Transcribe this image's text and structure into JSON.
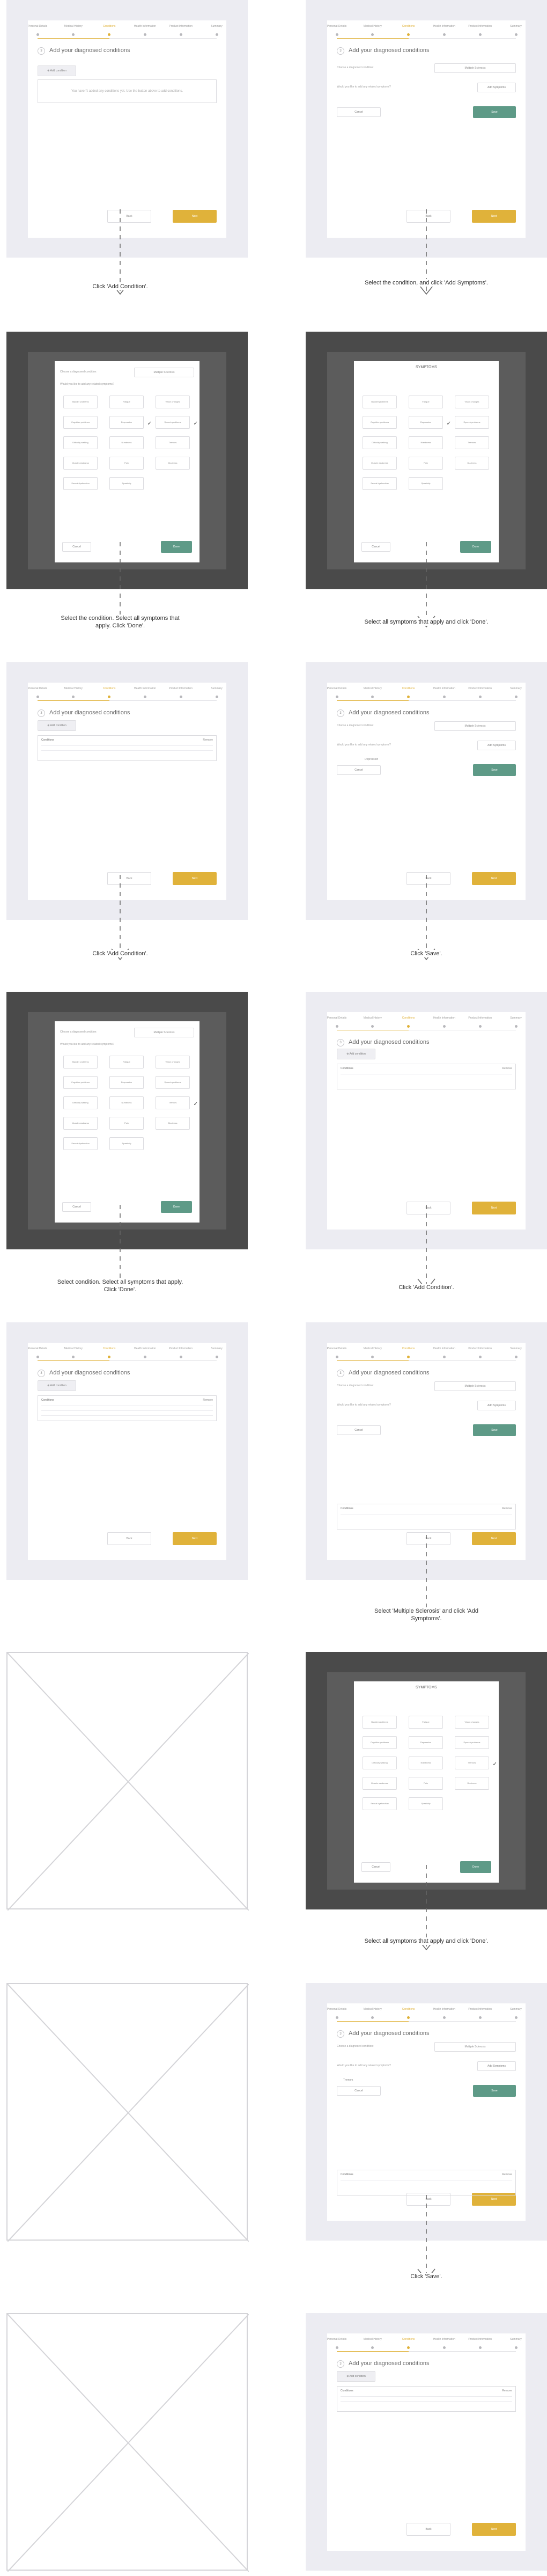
{
  "steps": [
    "Personal Details",
    "Medical History",
    "Conditions",
    "Health Information",
    "Product Information",
    "Summary"
  ],
  "section": {
    "number": "3",
    "title": "Add your diagnosed conditions"
  },
  "labels": {
    "add_condition": "Add condition",
    "empty": "You haven't added any conditions yet. Use the button above to add conditions.",
    "select_prompt": "Choose a diagnosed condition:",
    "select_value": "Multiple Sclerosis",
    "symptoms_prompt": "Would you like to add any related symptoms?",
    "add_symptoms": "Add Symptoms",
    "cancel": "Cancel",
    "save": "Save",
    "back": "Back",
    "next": "Next",
    "done": "Done",
    "symptoms_title": "SYMPTOMS",
    "conditions_header": "Conditions",
    "remove_header": "Remove"
  },
  "symptom_chips": [
    "Bladder problems",
    "Fatigue",
    "Vision changes",
    "Cognitive problems",
    "Depression",
    "Speech problems",
    "Difficulty walking",
    "Numbness",
    "Tremors",
    "Muscle weakness",
    "Pain",
    "Dizziness",
    "Sexual dysfunction",
    "Spasticity"
  ],
  "captions": [
    "Click 'Add Condition'.",
    "Select the condition, and click 'Add Symptoms'.",
    "Select the condition. Select all symptoms that apply. Click 'Done'.",
    "Select all symptoms that apply and click 'Done'.",
    "Click 'Add Condition'.",
    "Click 'Save'.",
    "Select condition. Select all symptoms that apply. Click 'Done'.",
    "Click 'Add Condition'.",
    "Select 'Multiple Sclerosis' and click 'Add Symptoms'.",
    "Select all symptoms that apply and click 'Done'.",
    "Click 'Save'."
  ]
}
